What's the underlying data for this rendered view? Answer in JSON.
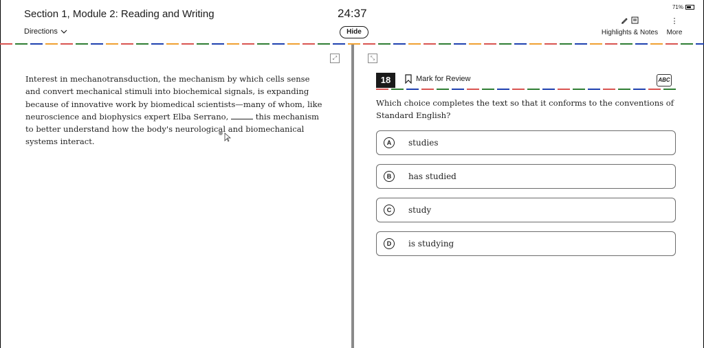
{
  "header": {
    "section_title": "Section 1, Module 2: Reading and Writing",
    "directions_label": "Directions",
    "timer": "24:37",
    "hide_label": "Hide",
    "battery": "71%",
    "highlights_label": "Highlights & Notes",
    "more_label": "More"
  },
  "passage": {
    "before_blank": "Interest in mechanotransduction, the mechanism by which cells sense and convert mechanical stimuli into biochemical signals, is expanding because of innovative work by biomedical scientists—many of whom, like neuroscience and biophysics expert Elba Serrano, ",
    "after_blank": " this mechanism to better understand how the body's neurological and biomechanical systems interact."
  },
  "question": {
    "number": "18",
    "mark_for_review": "Mark for Review",
    "abc_label": "ABC",
    "prompt": "Which choice completes the text so that it conforms to the conventions of Standard English?",
    "choices": [
      {
        "letter": "A",
        "text": "studies"
      },
      {
        "letter": "B",
        "text": "has studied"
      },
      {
        "letter": "C",
        "text": "study"
      },
      {
        "letter": "D",
        "text": "is studying"
      }
    ]
  }
}
